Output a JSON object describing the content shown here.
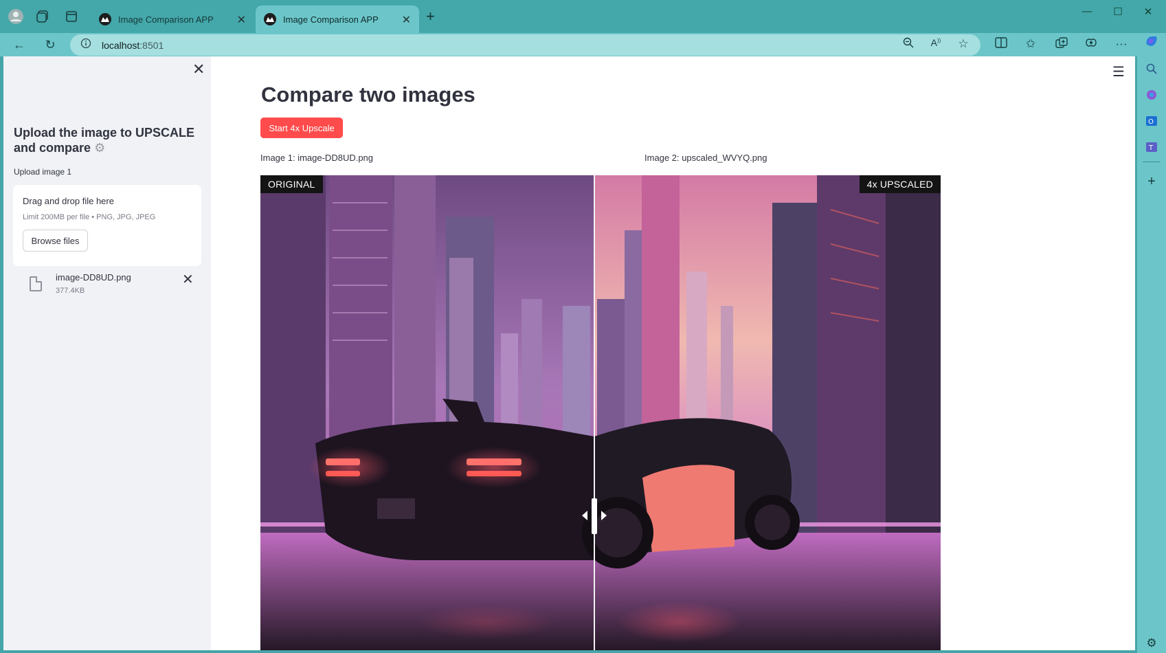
{
  "browser": {
    "tabs": [
      {
        "label": "Image Comparison APP",
        "active": false
      },
      {
        "label": "Image Comparison APP",
        "active": true
      }
    ],
    "url_host": "localhost",
    "url_port": ":8501"
  },
  "sidebar": {
    "title": "Upload the image to UPSCALE and compare",
    "uploader_label": "Upload image 1",
    "dropzone_title": "Drag and drop file here",
    "dropzone_limit": "Limit 200MB per file • PNG, JPG, JPEG",
    "browse_label": "Browse files",
    "file_name": "image-DD8UD.png",
    "file_size": "377.4KB"
  },
  "main": {
    "title": "Compare two images",
    "upscale_button": "Start 4x Upscale",
    "image1_caption": "Image 1: image-DD8UD.png",
    "image2_caption": "Image 2: upscaled_WVYQ.png",
    "left_badge": "ORIGINAL",
    "right_badge": "4x UPSCALED"
  },
  "colors": {
    "primary": "#ff4b4b",
    "sidebar_bg": "#f0f2f6",
    "browser_chrome": "#6cc6c9",
    "text": "#31333f"
  },
  "icons": [
    "profile-icon",
    "workspaces-icon",
    "tab-actions-icon",
    "back-icon",
    "refresh-icon",
    "info-icon",
    "zoom-icon",
    "read-aloud-icon",
    "favorite-icon",
    "split-screen-icon",
    "favorites-icon",
    "collections-icon",
    "extensions-icon",
    "more-icon",
    "copilot-icon",
    "search-icon",
    "settings-icon"
  ]
}
